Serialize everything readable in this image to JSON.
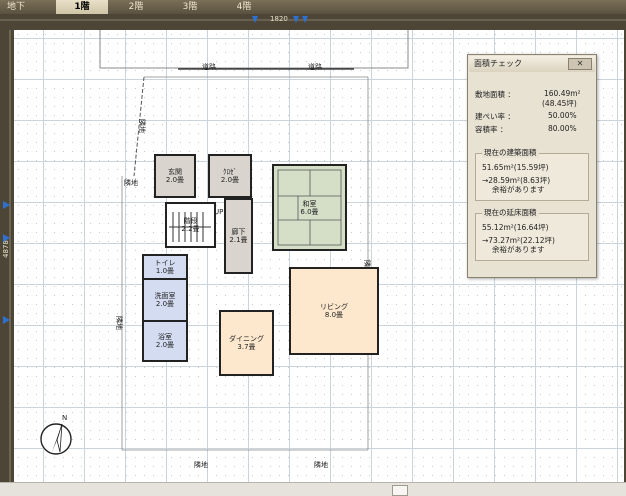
{
  "tabs": [
    {
      "label": "地下",
      "active": false
    },
    {
      "label": "1階",
      "active": true
    },
    {
      "label": "2階",
      "active": false
    },
    {
      "label": "3階",
      "active": false
    },
    {
      "label": "4階",
      "active": false
    }
  ],
  "rulers": {
    "top_dimension": "1820",
    "left_dimension": "4878"
  },
  "plan": {
    "road_labels": [
      "道路",
      "道路"
    ],
    "boundary_labels": [
      "隣地",
      "隣地",
      "隣地",
      "隣地",
      "隣地",
      "隣地"
    ],
    "rooms": {
      "entrance": {
        "name": "玄関",
        "size": "2.0畳"
      },
      "closet": {
        "name": "ｸﾛｾﾞ",
        "size": "2.0畳"
      },
      "stairs": {
        "name": "階段",
        "size": "2.2畳",
        "up": "UP"
      },
      "hall": {
        "name": "廊下",
        "size": "2.1畳"
      },
      "washitsu": {
        "name": "和室",
        "size": "6.0畳"
      },
      "toilet": {
        "name": "トイレ",
        "size": "1.0畳"
      },
      "washroom": {
        "name": "洗面室",
        "size": "2.0畳"
      },
      "bath": {
        "name": "浴室",
        "size": "2.0畳"
      },
      "dining": {
        "name": "ダイニング",
        "size": "3.7畳"
      },
      "living": {
        "name": "リビング",
        "size": "8.0畳"
      }
    }
  },
  "area_check": {
    "title": "面積チェック",
    "close": "✕",
    "site_area_label": "敷地面積 ：",
    "site_area_value": "160.49m²",
    "site_area_tsubo": "(48.45坪)",
    "coverage_label": "建ぺい率 ：",
    "coverage_value": "50.00%",
    "far_label": "容積率 ：",
    "far_value": "80.00%",
    "building_area_title": "現在の建築面積",
    "building_area_value": "51.65m²(15.59坪)",
    "building_area_limit": "→28.59m²(8.63坪)",
    "building_area_note": "余裕があります",
    "floor_area_title": "現在の延床面積",
    "floor_area_value": "55.12m²(16.64坪)",
    "floor_area_limit": "→73.27m²(22.12坪)",
    "floor_area_note": "余裕があります"
  },
  "compass": {
    "north": "N"
  },
  "colors": {
    "toolbar": "#5a5140",
    "ruler": "#4d4637",
    "marker": "#2f6fd0"
  }
}
